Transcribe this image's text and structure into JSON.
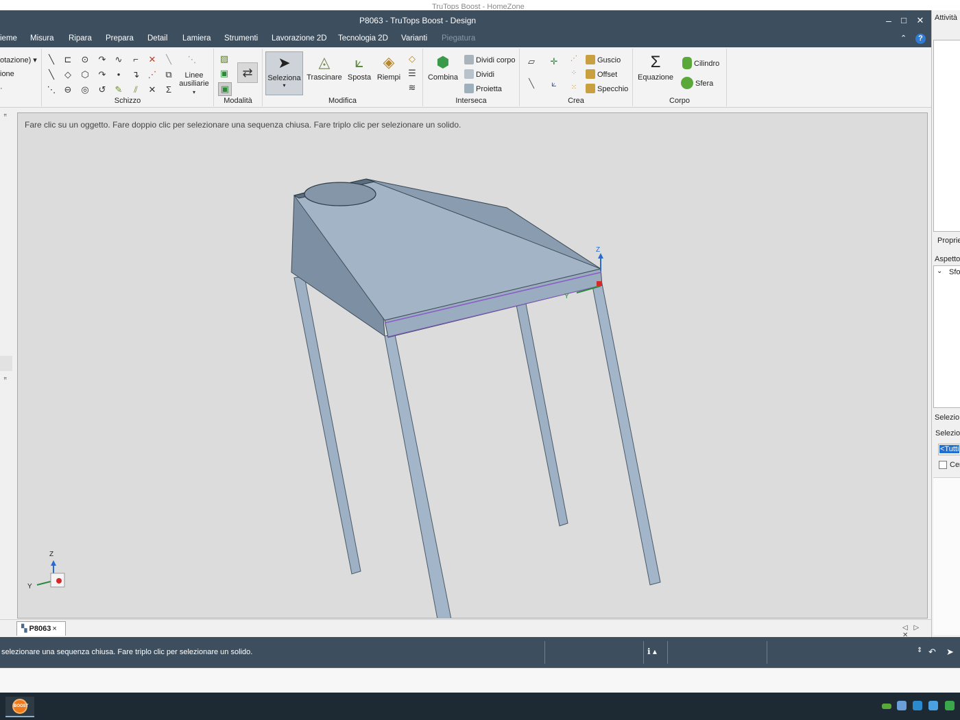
{
  "background_window_title": "TruTops Boost - HomeZone",
  "window": {
    "title": "P8063 - TruTops Boost - Design",
    "minimize": "–",
    "maximize": "□",
    "close": "✕"
  },
  "menu": {
    "items": [
      "ieme",
      "Misura",
      "Ripara",
      "Prepara",
      "Detail",
      "Lamiera",
      "Strumenti",
      "Lavorazione 2D",
      "Tecnologia 2D",
      "Varianti",
      "Piegatura"
    ],
    "collapse": "⌃",
    "help": "?"
  },
  "ribbon": {
    "partial_items": [
      "otazione) ▾",
      "ione",
      "·"
    ],
    "groups": {
      "schizzo": {
        "label": "Schizzo",
        "aux_lines": "Linee ausiliarie"
      },
      "modalita": {
        "label": "Modalità"
      },
      "modifica": {
        "label": "Modifica",
        "buttons": [
          "Seleziona",
          "Trascinare",
          "Sposta",
          "Riempi"
        ]
      },
      "interseca": {
        "label": "Interseca",
        "combina": "Combina",
        "small": [
          "Dividi corpo",
          "Dividi",
          "Proietta"
        ]
      },
      "crea": {
        "label": "Crea",
        "small": [
          "Guscio",
          "Offset",
          "Specchio"
        ]
      },
      "corpo": {
        "label": "Corpo",
        "equazione": "Equazione",
        "small": [
          "Cilindro",
          "Sfera"
        ]
      }
    }
  },
  "viewport": {
    "hint": "Fare clic su un oggetto. Fare doppio clic per selezionare una sequenza chiusa. Fare triplo clic per selezionare un solido.",
    "axis_labels": {
      "z": "Z",
      "y": "Y"
    }
  },
  "document_tab": {
    "name": "P8063",
    "close": "×"
  },
  "tab_nav": "◁ ▷ ✕",
  "status": {
    "message": "selezionare una sequenza chiusa. Fare triplo clic per selezionare un solido.",
    "info": "ℹ ▴"
  },
  "right_panel": {
    "title": "Attività",
    "properties": "Proprie",
    "appearance": "Aspetto",
    "tree_item": "Sfo",
    "selection_title": "Selezio",
    "selection_label": "Selezio",
    "selection_value": "<Tutti",
    "checkbox_label": "Cer"
  },
  "taskbar": {
    "start_logo": "BOOST"
  },
  "colors": {
    "chrome": "#3d4f5f",
    "viewport_bg": "#dcdcdc",
    "model_top": "#a2b4c5",
    "model_side": "#7d8fa3",
    "edge_highlight": "#8a5cc8",
    "taskbar": "#1d2a33"
  }
}
